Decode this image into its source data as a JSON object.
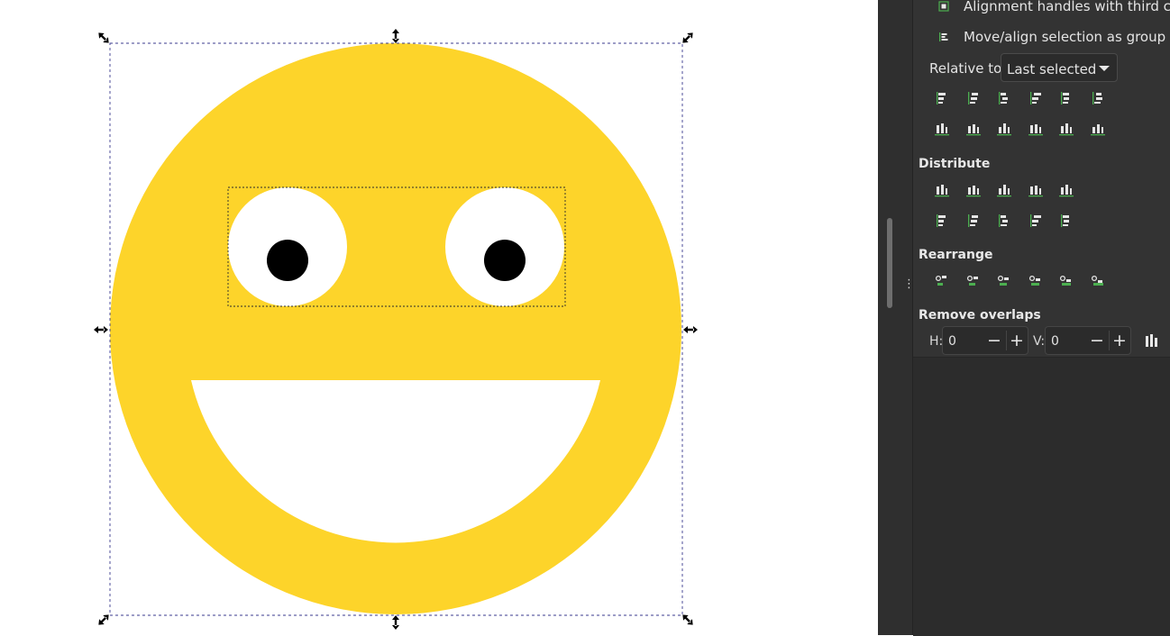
{
  "colors": {
    "face": "#fdd42a",
    "eye_white": "#ffffff",
    "pupil": "#000000",
    "mouth": "#ffffff",
    "selection_dash": "#3b3b8f",
    "panel_bg": "#333333",
    "icon_green": "#4caf50"
  },
  "align_panel": {
    "options": [
      {
        "label": "Alignment handles with third click",
        "icon": "square-handle-icon"
      },
      {
        "label": "Move/align selection as group",
        "icon": "group-align-icon"
      }
    ],
    "relative_to": {
      "label": "Relative to:",
      "value": "Last selected"
    },
    "sections": {
      "distribute": "Distribute",
      "rearrange": "Rearrange",
      "remove_overlaps": "Remove overlaps"
    },
    "align_rows": [
      [
        "align-right-edge-icon",
        "align-left-edge-icon",
        "center-vertical-axis-icon",
        "align-left-to-right-icon",
        "align-right-to-left-icon",
        "align-text-anchor-icon"
      ],
      [
        "align-bottom-edge-icon",
        "align-top-edge-icon",
        "center-horizontal-axis-icon",
        "align-top-to-bottom-icon",
        "align-bottom-to-top-icon",
        "align-baseline-icon"
      ]
    ],
    "distribute_rows": [
      [
        "distribute-left-icon",
        "distribute-centers-h-icon",
        "distribute-right-icon",
        "distribute-gaps-h-icon",
        "distribute-baseline-h-icon"
      ],
      [
        "distribute-top-icon",
        "distribute-centers-v-icon",
        "distribute-bottom-icon",
        "distribute-gaps-v-icon",
        "distribute-baseline-v-icon"
      ]
    ],
    "rearrange_icons": [
      "graph-layout-icon",
      "exchange-selection-icon",
      "exchange-z-order-icon",
      "exchange-clockwise-icon",
      "randomize-positions-icon",
      "unclump-icon"
    ],
    "overlaps": {
      "h_label": "H:",
      "h_value": "0",
      "v_label": "V:",
      "v_value": "0",
      "minus": "−",
      "plus": "+",
      "apply_icon": "remove-overlaps-icon"
    }
  }
}
